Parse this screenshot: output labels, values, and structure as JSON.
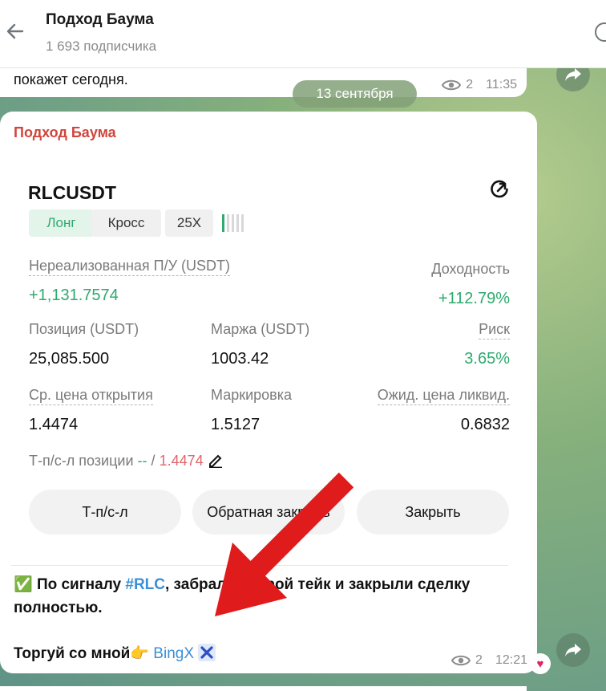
{
  "header": {
    "title": "Подход Баума",
    "subscribers": "1 693 подписчика"
  },
  "prev_message": {
    "text": "покажет сегодня.",
    "views": "2",
    "time": "11:35"
  },
  "date_divider": "13 сентября",
  "message": {
    "author": "Подход Баума",
    "card": {
      "pair": "RLCUSDT",
      "tags": {
        "side": "Лонг",
        "margin_mode": "Кросс",
        "leverage": "25X"
      },
      "risk_bars_level": 0.2,
      "unrealized_label": "Нереализованная П/У (USDT)",
      "unrealized_value": "+1,131.7574",
      "roi_label": "Доходность",
      "roi_value": "+112.79%",
      "position_label": "Позиция (USDT)",
      "position_value": "25,085.500",
      "margin_label": "Маржа (USDT)",
      "margin_value": "1003.42",
      "risk_label": "Риск",
      "risk_value": "3.65%",
      "entry_label": "Ср. цена открытия",
      "entry_value": "1.4474",
      "mark_label": "Маркировка",
      "mark_value": "1.5127",
      "liq_label": "Ожид. цена ликвид.",
      "liq_value": "0.6832",
      "tpsl_label": "Т-п/с-л позиции",
      "tpsl_tp": "--",
      "tpsl_sep": " / ",
      "tpsl_sl": "1.4474",
      "buttons": {
        "tpsl": "Т-п/с-л",
        "reverse": "Обратная закрыть",
        "close": "Закрыть"
      }
    },
    "text_emoji": "✅",
    "text_before": " По сигналу ",
    "hashtag": "#RLC",
    "text_after": ", забрали второй тейк и закрыли сделку полностью.",
    "trade_prefix": "Торгуй со мной",
    "trade_emoji": "👉",
    "trade_link": "BingX",
    "trade_link_icon": "x-logo-icon",
    "views": "2",
    "time": "12:21",
    "reaction": "♥"
  },
  "colors": {
    "accent_green": "#2eaa6e",
    "author_red": "#d0453c",
    "link_blue": "#3a8fd6",
    "arrow_red": "#e01b1b"
  }
}
